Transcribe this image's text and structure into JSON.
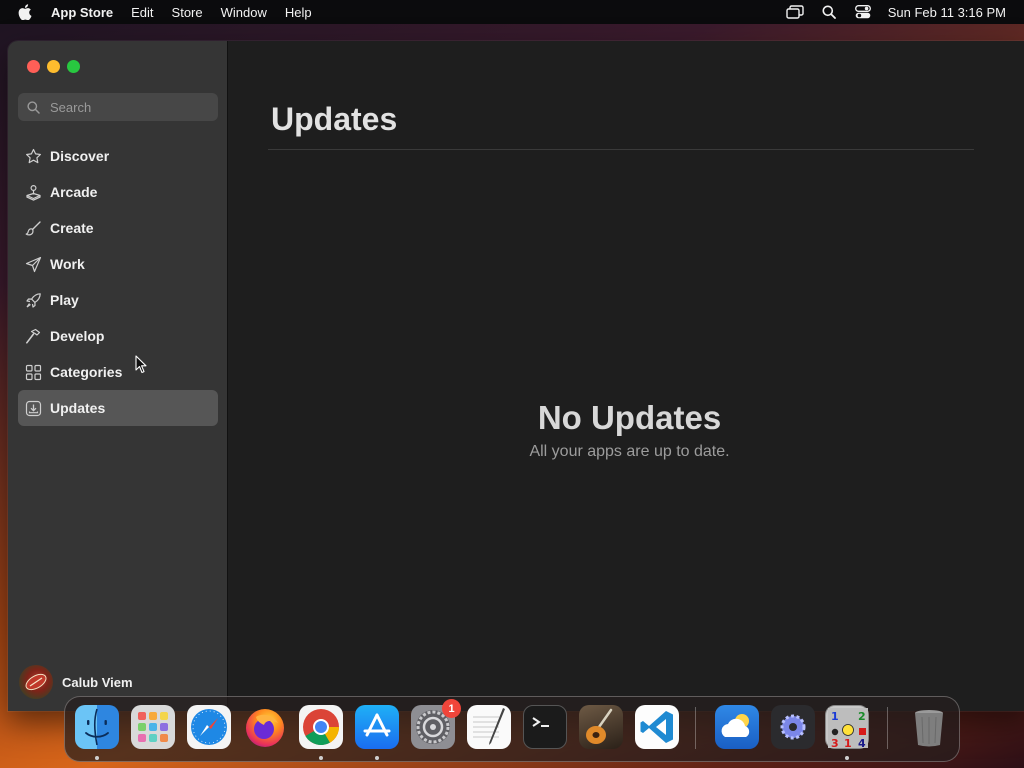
{
  "menubar": {
    "app_name": "App Store",
    "menus": [
      "Edit",
      "Store",
      "Window",
      "Help"
    ],
    "clock": "Sun Feb 11  3:16 PM",
    "status_icons": [
      "screen-mirroring-icon",
      "spotlight-search-icon",
      "control-center-icon"
    ]
  },
  "window": {
    "controls": [
      "close",
      "minimize",
      "zoom"
    ],
    "sidebar": {
      "search_placeholder": "Search",
      "items": [
        {
          "label": "Discover",
          "icon": "star-icon",
          "active": false
        },
        {
          "label": "Arcade",
          "icon": "joystick-icon",
          "active": false
        },
        {
          "label": "Create",
          "icon": "paintbrush-icon",
          "active": false
        },
        {
          "label": "Work",
          "icon": "paper-plane-icon",
          "active": false
        },
        {
          "label": "Play",
          "icon": "rocket-icon",
          "active": false
        },
        {
          "label": "Develop",
          "icon": "hammer-icon",
          "active": false
        },
        {
          "label": "Categories",
          "icon": "grid-icon",
          "active": false
        },
        {
          "label": "Updates",
          "icon": "download-tray-icon",
          "active": true
        }
      ],
      "user_name": "Calub Viem"
    },
    "main": {
      "title": "Updates",
      "empty_title": "No Updates",
      "empty_subtitle": "All your apps are up to date."
    }
  },
  "dock": {
    "apps": [
      {
        "name": "finder-icon",
        "running": true
      },
      {
        "name": "launchpad-icon",
        "running": false
      },
      {
        "name": "safari-icon",
        "running": false
      },
      {
        "name": "firefox-icon",
        "running": false
      },
      {
        "name": "chrome-icon",
        "running": true
      },
      {
        "name": "app-store-icon",
        "running": true
      },
      {
        "name": "system-settings-icon",
        "running": false,
        "badge": "1"
      },
      {
        "name": "textedit-icon",
        "running": false
      },
      {
        "name": "terminal-icon",
        "running": false
      },
      {
        "name": "garageband-icon",
        "running": false
      },
      {
        "name": "vscode-icon",
        "running": false
      },
      {
        "name": "weather-icon",
        "running": false
      },
      {
        "name": "settings-gear-icon",
        "running": false
      },
      {
        "name": "minesweeper-icon",
        "running": true
      },
      {
        "name": "trash-icon",
        "running": false
      }
    ]
  }
}
